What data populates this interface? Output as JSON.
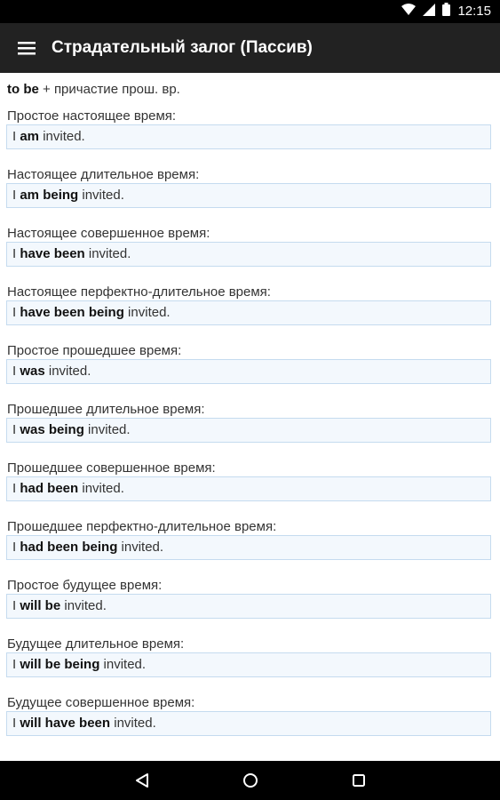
{
  "status_bar": {
    "time": "12:15",
    "icons": [
      "wifi-icon",
      "signal-icon",
      "battery-icon"
    ]
  },
  "app_bar": {
    "title": "Страдательный залог (Пассив)",
    "menu_icon": "hamburger-menu-icon"
  },
  "formula": {
    "bold": "to be",
    "rest": " + причастие прош. вр."
  },
  "tenses": [
    {
      "label": "Простое настоящее время:",
      "subject": "I ",
      "aux": "am",
      "verb": " invited."
    },
    {
      "label": "Настоящее длительное время:",
      "subject": "I ",
      "aux": "am being",
      "verb": " invited."
    },
    {
      "label": "Настоящее совершенное время:",
      "subject": "I ",
      "aux": "have been",
      "verb": " invited."
    },
    {
      "label": "Настоящее перфектно-длительное время:",
      "subject": "I ",
      "aux": "have been being",
      "verb": " invited."
    },
    {
      "label": "Простое прошедшее время:",
      "subject": "I ",
      "aux": "was",
      "verb": " invited."
    },
    {
      "label": "Прошедшее длительное время:",
      "subject": "I ",
      "aux": "was being",
      "verb": " invited."
    },
    {
      "label": "Прошедшее совершенное время:",
      "subject": "I ",
      "aux": "had been",
      "verb": " invited."
    },
    {
      "label": "Прошедшее перфектно-длительное время:",
      "subject": "I ",
      "aux": "had been being",
      "verb": " invited."
    },
    {
      "label": "Простое будущее время:",
      "subject": "I ",
      "aux": "will be",
      "verb": " invited."
    },
    {
      "label": "Будущее длительное время:",
      "subject": "I ",
      "aux": "will be being",
      "verb": " invited."
    },
    {
      "label": "Будущее совершенное время:",
      "subject": "I ",
      "aux": "will have been",
      "verb": " invited."
    }
  ],
  "nav_bar": {
    "icons": [
      "back-icon",
      "home-icon",
      "recents-icon"
    ]
  },
  "colors": {
    "status_bar": "#000000",
    "app_bar": "#222222",
    "example_bg": "#f3f8fd",
    "example_border": "#c5dbef"
  }
}
